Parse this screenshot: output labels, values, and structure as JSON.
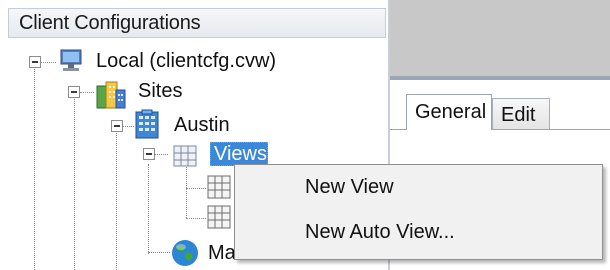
{
  "window": {
    "pane_title": "Client Configurations"
  },
  "tree": {
    "root_label": "Local (clientcfg.cvw)",
    "sites_label": "Sites",
    "austin_label": "Austin",
    "views_label": "Views",
    "partial_node_label": "Ma",
    "icons": {
      "root": "computer-icon",
      "sites": "buildings-icon",
      "austin": "building-icon",
      "views": "grid-icon",
      "child_view": "grid-icon",
      "map": "globe-icon"
    }
  },
  "tabs": [
    {
      "label": "General"
    },
    {
      "label": "Edit"
    }
  ],
  "context_menu": {
    "items": [
      {
        "label": "New View"
      },
      {
        "label": "New Auto View..."
      }
    ]
  },
  "colors": {
    "selection": "#3d87d8",
    "right_pane_top": "#c8c8c8",
    "menu_background": "#f1f1f1"
  }
}
